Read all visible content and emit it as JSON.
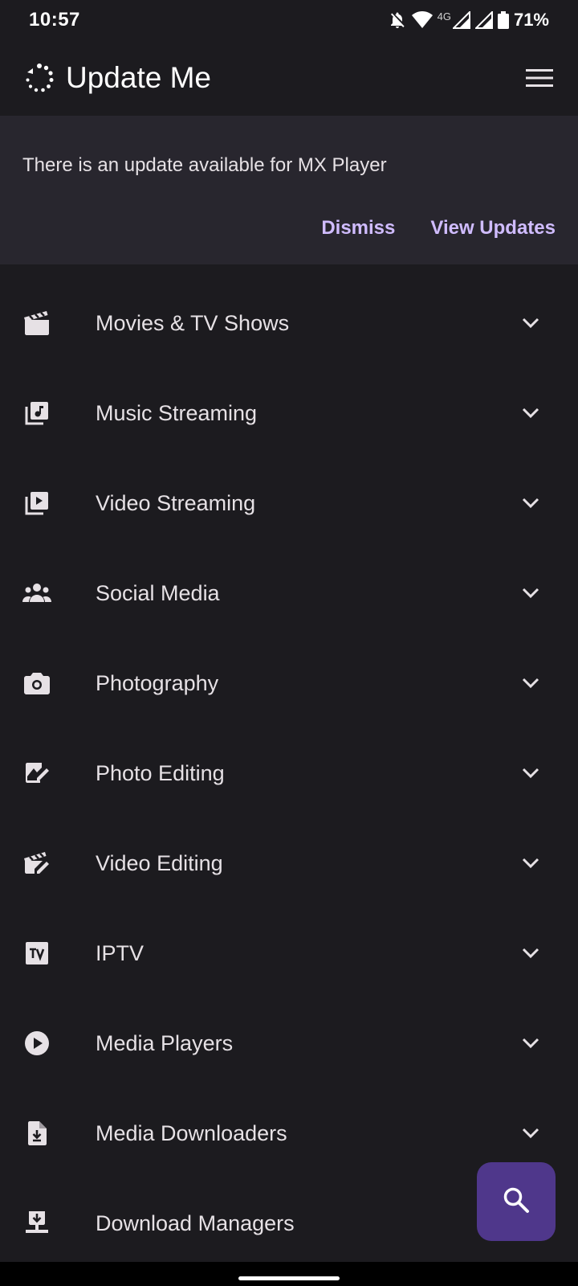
{
  "status_bar": {
    "time": "10:57",
    "network": "4G",
    "battery": "71%",
    "icons": [
      "notifications-off-icon",
      "wifi-icon",
      "signal-icon",
      "signal-icon",
      "battery-icon"
    ]
  },
  "app_bar": {
    "title": "Update Me",
    "logo_icon": "update-logo-icon",
    "menu_icon": "hamburger-menu-icon"
  },
  "banner": {
    "message": "There is an update available for MX Player",
    "dismiss_label": "Dismiss",
    "view_updates_label": "View Updates"
  },
  "categories": [
    {
      "label": "Movies & TV Shows",
      "icon": "movie-clapper-icon"
    },
    {
      "label": "Music Streaming",
      "icon": "music-library-icon"
    },
    {
      "label": "Video Streaming",
      "icon": "video-library-icon"
    },
    {
      "label": "Social Media",
      "icon": "group-icon"
    },
    {
      "label": "Photography",
      "icon": "camera-icon"
    },
    {
      "label": "Photo Editing",
      "icon": "photo-edit-icon"
    },
    {
      "label": "Video Editing",
      "icon": "video-edit-icon"
    },
    {
      "label": "IPTV",
      "icon": "tv-icon"
    },
    {
      "label": "Media Players",
      "icon": "play-circle-icon"
    },
    {
      "label": "Media Downloaders",
      "icon": "file-download-icon"
    },
    {
      "label": "Download Managers",
      "icon": "download-tray-icon"
    }
  ],
  "fab": {
    "icon": "search-icon"
  },
  "colors": {
    "background": "#1c1b1f",
    "banner": "#28262e",
    "accent_text": "#d0bcff",
    "fab": "#4f378b"
  }
}
